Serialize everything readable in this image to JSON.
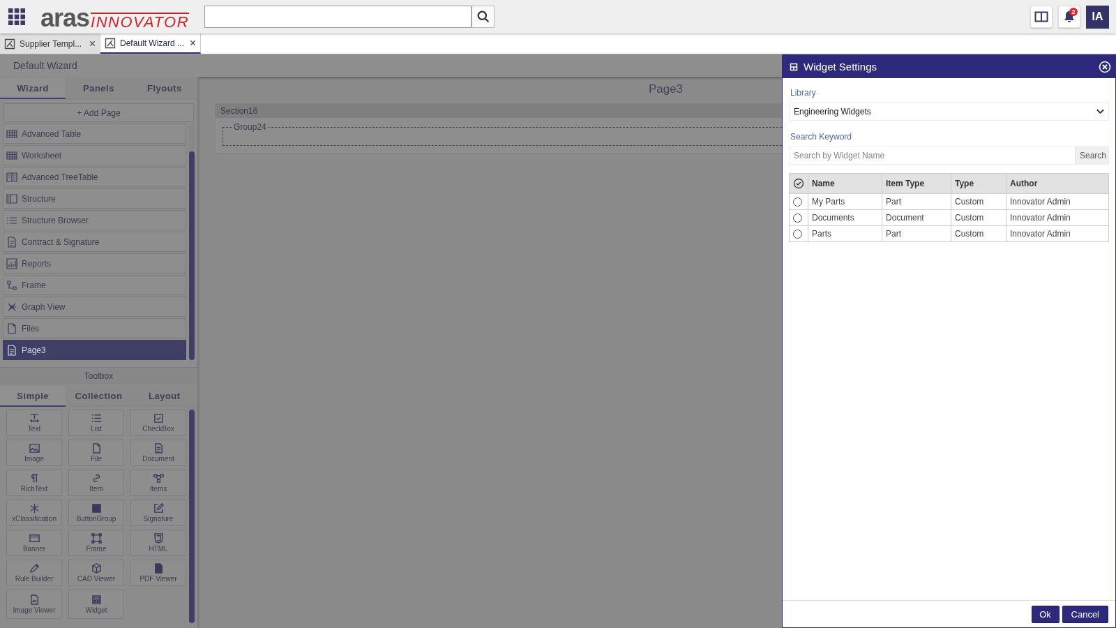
{
  "top_bar": {
    "logo": {
      "word": "aras",
      "product": "INNOVATOR"
    },
    "notifications": {
      "count": "2"
    },
    "user": {
      "initials": "IA"
    }
  },
  "tabs": [
    {
      "label": "Supplier Templ...",
      "selected": false
    },
    {
      "label": "Default Wizard ...",
      "selected": true
    }
  ],
  "wizard": {
    "title": "Default Wizard",
    "tabs": [
      {
        "label": "Wizard",
        "selected": true
      },
      {
        "label": "Panels",
        "selected": false
      },
      {
        "label": "Flyouts",
        "selected": false
      }
    ],
    "add_page": "+ Add Page",
    "pages": [
      {
        "label": "Advanced Table",
        "kind": "table",
        "selected": false
      },
      {
        "label": "Worksheet",
        "kind": "table",
        "selected": false
      },
      {
        "label": "Advanced TreeTable",
        "kind": "treetable",
        "selected": false
      },
      {
        "label": "Structure",
        "kind": "structure",
        "selected": false
      },
      {
        "label": "Structure Browser",
        "kind": "browser",
        "selected": false
      },
      {
        "label": "Contract & Signature",
        "kind": "document",
        "selected": false
      },
      {
        "label": "Reports",
        "kind": "chart",
        "selected": false
      },
      {
        "label": "Frame",
        "kind": "diagram",
        "selected": false
      },
      {
        "label": "Graph View",
        "kind": "graph",
        "selected": false
      },
      {
        "label": "Files",
        "kind": "file",
        "selected": false
      },
      {
        "label": "Page3",
        "kind": "document",
        "selected": true
      }
    ],
    "toolbox": {
      "title": "Toolbox",
      "tabs": [
        {
          "label": "Simple",
          "selected": true
        },
        {
          "label": "Collection",
          "selected": false
        },
        {
          "label": "Layout",
          "selected": false
        }
      ],
      "items": [
        {
          "label": "Text",
          "kind": "text"
        },
        {
          "label": "List",
          "kind": "list"
        },
        {
          "label": "CheckBox",
          "kind": "checkbox"
        },
        {
          "label": "Image",
          "kind": "image"
        },
        {
          "label": "File",
          "kind": "file"
        },
        {
          "label": "Document",
          "kind": "document"
        },
        {
          "label": "RichText",
          "kind": "pilcrow"
        },
        {
          "label": "Item",
          "kind": "link"
        },
        {
          "label": "Items",
          "kind": "hierarchy"
        },
        {
          "label": "xClassification",
          "kind": "asterisk"
        },
        {
          "label": "ButtonGroup",
          "kind": "square"
        },
        {
          "label": "Signature",
          "kind": "edit"
        },
        {
          "label": "Banner",
          "kind": "banner"
        },
        {
          "label": "Frame",
          "kind": "frame"
        },
        {
          "label": "HTML",
          "kind": "shield"
        },
        {
          "label": "Rule Builder",
          "kind": "pencil"
        },
        {
          "label": "CAD Viewer",
          "kind": "cube"
        },
        {
          "label": "PDF Viewer",
          "kind": "pdf"
        },
        {
          "label": "Image Viewer",
          "kind": "imagefile"
        },
        {
          "label": "Widget",
          "kind": "widget"
        }
      ]
    }
  },
  "canvas": {
    "page_title": "Page3",
    "section": "Section16",
    "group": "Group24"
  },
  "dialog": {
    "title": "Widget Settings",
    "library_label": "Library",
    "library_value": "Engineering Widgets",
    "search_label": "Search Keyword",
    "search_placeholder": "Search by Widget Name",
    "search_button": "Search",
    "columns": [
      "Name",
      "Item Type",
      "Type",
      "Author"
    ],
    "rows": [
      {
        "cells": [
          "My Parts",
          "Part",
          "Custom",
          "Innovator Admin"
        ],
        "selected": false
      },
      {
        "cells": [
          "Documents",
          "Document",
          "Custom",
          "Innovator Admin"
        ],
        "selected": false
      },
      {
        "cells": [
          "Parts",
          "Part",
          "Custom",
          "Innovator Admin"
        ],
        "selected": false
      }
    ],
    "buttons": [
      "Ok",
      "Cancel"
    ]
  }
}
